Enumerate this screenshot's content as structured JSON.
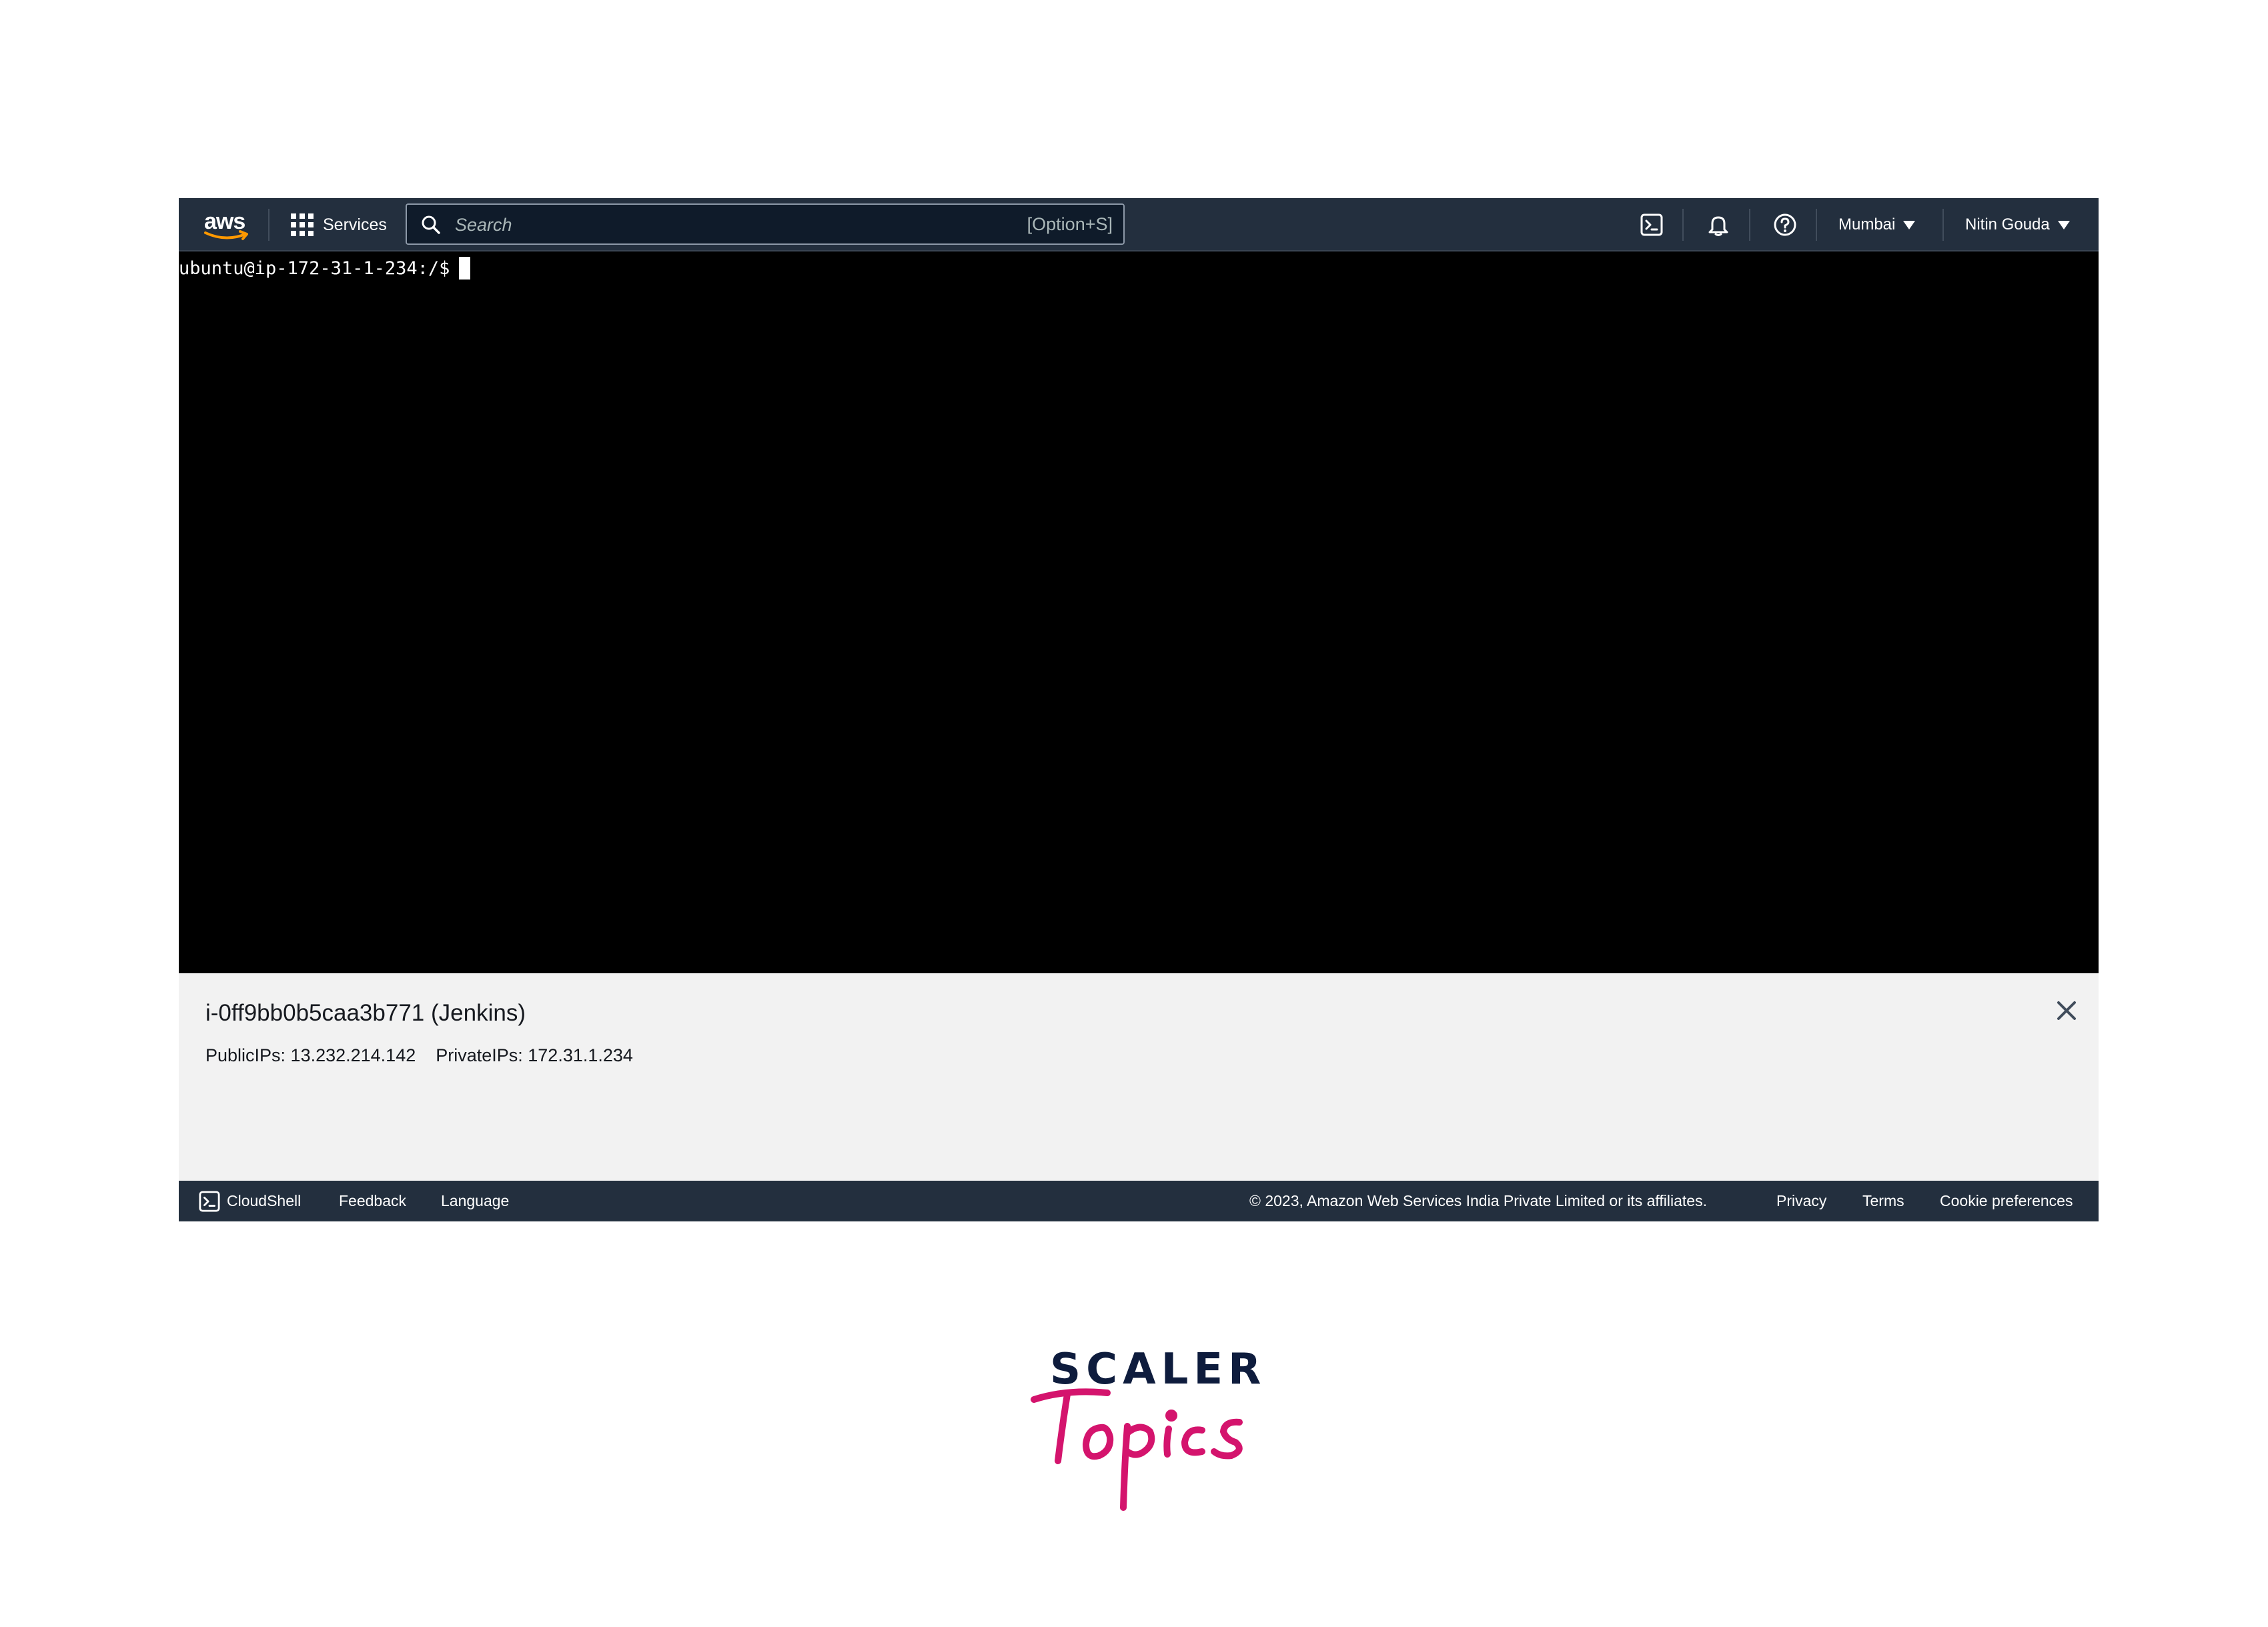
{
  "topnav": {
    "logo_text": "aws",
    "services_label": "Services",
    "search_placeholder": "Search",
    "search_shortcut": "[Option+S]",
    "icons": [
      "cloudshell-icon",
      "bell-icon",
      "help-icon"
    ],
    "region": "Mumbai",
    "user": "Nitin Gouda"
  },
  "terminal": {
    "prompt": "ubuntu@ip-172-31-1-234:/$"
  },
  "instance": {
    "title": "i-0ff9bb0b5caa3b771 (Jenkins)",
    "public_ips": "PublicIPs: 13.232.214.142",
    "private_ips": "PrivateIPs: 172.31.1.234"
  },
  "footer": {
    "cloudshell": "CloudShell",
    "feedback": "Feedback",
    "language": "Language",
    "copyright": "© 2023, Amazon Web Services India Private Limited or its affiliates.",
    "privacy": "Privacy",
    "terms": "Terms",
    "cookie": "Cookie preferences"
  },
  "brand": {
    "line1": "SCALER",
    "line2": "Topics"
  },
  "colors": {
    "nav_bg": "#232f3e",
    "terminal_bg": "#000000",
    "panel_bg": "#f2f2f2",
    "aws_orange": "#ff9900",
    "brand_pink": "#d4146d",
    "brand_navy": "#0e1c3d"
  }
}
